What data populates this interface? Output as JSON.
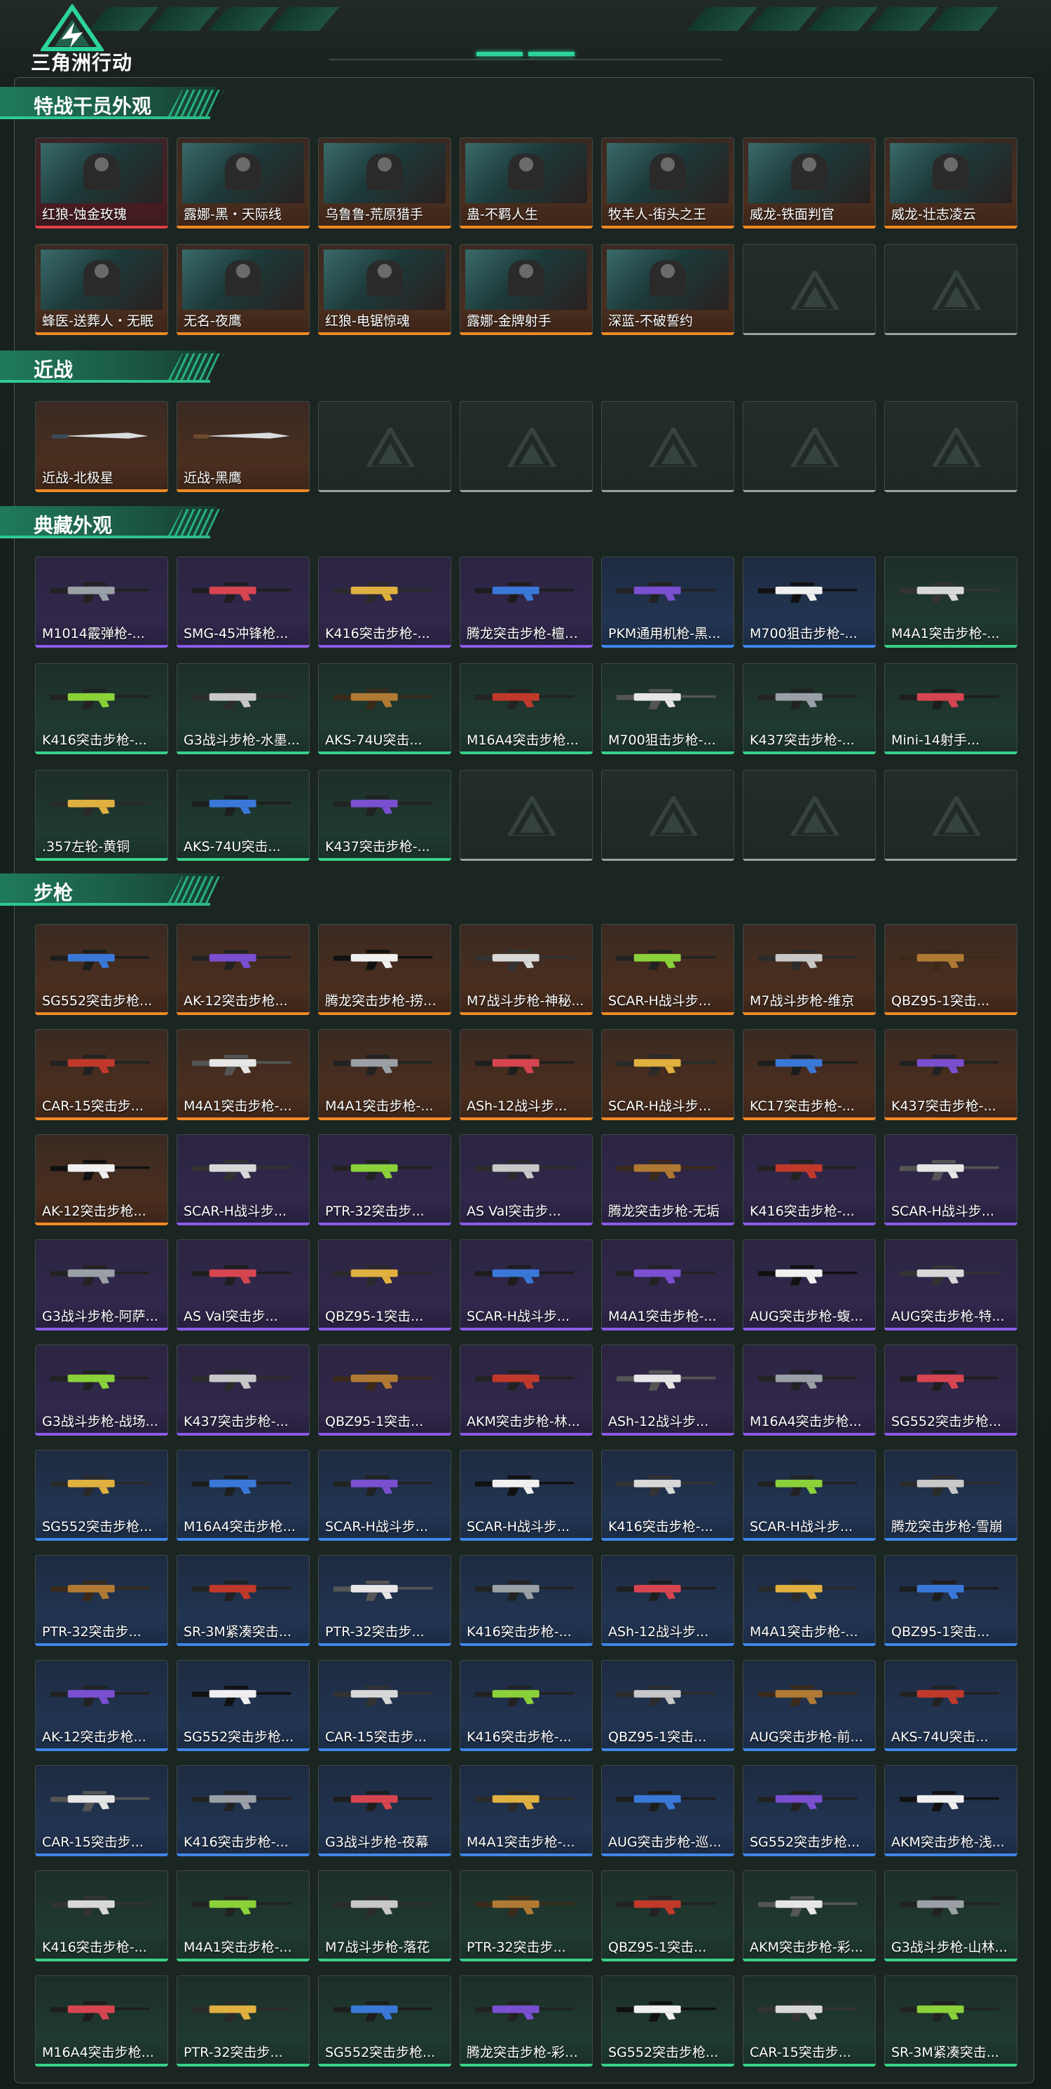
{
  "header": {
    "brand": "三角洲行动"
  },
  "sections": [
    {
      "id": "operators",
      "title": "特战干员外观",
      "items": [
        {
          "label": "红狼-蚀金玫瑰",
          "rarity": "red",
          "kind": "portrait"
        },
        {
          "label": "露娜-黑・天际线",
          "rarity": "orange",
          "kind": "portrait"
        },
        {
          "label": "乌鲁鲁-荒原猎手",
          "rarity": "orange",
          "kind": "portrait"
        },
        {
          "label": "蛊-不羁人生",
          "rarity": "orange",
          "kind": "portrait"
        },
        {
          "label": "牧羊人-街头之王",
          "rarity": "orange",
          "kind": "portrait"
        },
        {
          "label": "威龙-铁面判官",
          "rarity": "orange",
          "kind": "portrait"
        },
        {
          "label": "威龙-壮志凌云",
          "rarity": "orange",
          "kind": "portrait"
        },
        {
          "label": "蜂医-送葬人・无眠",
          "rarity": "orange",
          "kind": "portrait"
        },
        {
          "label": "无名-夜鹰",
          "rarity": "orange",
          "kind": "portrait"
        },
        {
          "label": "红狼-电锯惊魂",
          "rarity": "orange",
          "kind": "portrait"
        },
        {
          "label": "露娜-金牌射手",
          "rarity": "orange",
          "kind": "portrait"
        },
        {
          "label": "深蓝-不破誓约",
          "rarity": "orange",
          "kind": "portrait"
        },
        {
          "label": "",
          "rarity": "empty",
          "kind": "empty"
        },
        {
          "label": "",
          "rarity": "empty",
          "kind": "empty"
        }
      ]
    },
    {
      "id": "melee",
      "title": "近战",
      "items": [
        {
          "label": "近战-北极星",
          "rarity": "orange",
          "kind": "knife"
        },
        {
          "label": "近战-黑鹰",
          "rarity": "orange",
          "kind": "knife"
        },
        {
          "label": "",
          "rarity": "empty",
          "kind": "empty"
        },
        {
          "label": "",
          "rarity": "empty",
          "kind": "empty"
        },
        {
          "label": "",
          "rarity": "empty",
          "kind": "empty"
        },
        {
          "label": "",
          "rarity": "empty",
          "kind": "empty"
        },
        {
          "label": "",
          "rarity": "empty",
          "kind": "empty"
        }
      ]
    },
    {
      "id": "collection",
      "title": "典藏外观",
      "items": [
        {
          "label": "M1014霰弹枪-...",
          "rarity": "purple",
          "kind": "gun"
        },
        {
          "label": "SMG-45冲锋枪...",
          "rarity": "purple",
          "kind": "gun"
        },
        {
          "label": "K416突击步枪-...",
          "rarity": "purple",
          "kind": "gun"
        },
        {
          "label": "腾龙突击步枪-檀劫...",
          "rarity": "purple",
          "kind": "gun"
        },
        {
          "label": "PKM通用机枪-黑...",
          "rarity": "blue",
          "kind": "gun"
        },
        {
          "label": "M700狙击步枪-...",
          "rarity": "blue",
          "kind": "gun"
        },
        {
          "label": "M4A1突击步枪-...",
          "rarity": "green",
          "kind": "gun"
        },
        {
          "label": "K416突击步枪-...",
          "rarity": "green",
          "kind": "gun"
        },
        {
          "label": "G3战斗步枪-水墨...",
          "rarity": "green",
          "kind": "gun"
        },
        {
          "label": "AKS-74U突击...",
          "rarity": "green",
          "kind": "gun"
        },
        {
          "label": "M16A4突击步枪...",
          "rarity": "green",
          "kind": "gun"
        },
        {
          "label": "M700狙击步枪-...",
          "rarity": "green",
          "kind": "gun"
        },
        {
          "label": "K437突击步枪-...",
          "rarity": "green",
          "kind": "gun"
        },
        {
          "label": "Mini-14射手...",
          "rarity": "green",
          "kind": "gun"
        },
        {
          "label": ".357左轮-黄铜",
          "rarity": "green",
          "kind": "gun"
        },
        {
          "label": "AKS-74U突击...",
          "rarity": "green",
          "kind": "gun"
        },
        {
          "label": "K437突击步枪-...",
          "rarity": "green",
          "kind": "gun"
        },
        {
          "label": "",
          "rarity": "empty",
          "kind": "empty"
        },
        {
          "label": "",
          "rarity": "empty",
          "kind": "empty"
        },
        {
          "label": "",
          "rarity": "empty",
          "kind": "empty"
        },
        {
          "label": "",
          "rarity": "empty",
          "kind": "empty"
        }
      ]
    },
    {
      "id": "rifles",
      "title": "步枪",
      "items": [
        {
          "label": "SG552突击步枪...",
          "rarity": "orange",
          "kind": "gun"
        },
        {
          "label": "AK-12突击步枪...",
          "rarity": "orange",
          "kind": "gun"
        },
        {
          "label": "腾龙突击步枪-捞点...",
          "rarity": "orange",
          "kind": "gun"
        },
        {
          "label": "M7战斗步枪-神秘...",
          "rarity": "orange",
          "kind": "gun"
        },
        {
          "label": "SCAR-H战斗步...",
          "rarity": "orange",
          "kind": "gun"
        },
        {
          "label": "M7战斗步枪-维京",
          "rarity": "orange",
          "kind": "gun"
        },
        {
          "label": "QBZ95-1突击...",
          "rarity": "orange",
          "kind": "gun"
        },
        {
          "label": "CAR-15突击步...",
          "rarity": "orange",
          "kind": "gun"
        },
        {
          "label": "M4A1突击步枪-...",
          "rarity": "orange",
          "kind": "gun"
        },
        {
          "label": "M4A1突击步枪-...",
          "rarity": "orange",
          "kind": "gun"
        },
        {
          "label": "ASh-12战斗步...",
          "rarity": "orange",
          "kind": "gun"
        },
        {
          "label": "SCAR-H战斗步...",
          "rarity": "orange",
          "kind": "gun"
        },
        {
          "label": "KC17突击步枪-...",
          "rarity": "orange",
          "kind": "gun"
        },
        {
          "label": "K437突击步枪-...",
          "rarity": "orange",
          "kind": "gun"
        },
        {
          "label": "AK-12突击步枪...",
          "rarity": "orange",
          "kind": "gun"
        },
        {
          "label": "SCAR-H战斗步...",
          "rarity": "purple",
          "kind": "gun"
        },
        {
          "label": "PTR-32突击步...",
          "rarity": "purple",
          "kind": "gun"
        },
        {
          "label": "AS Val突击步...",
          "rarity": "purple",
          "kind": "gun"
        },
        {
          "label": "腾龙突击步枪-无垢",
          "rarity": "purple",
          "kind": "gun"
        },
        {
          "label": "K416突击步枪-...",
          "rarity": "purple",
          "kind": "gun"
        },
        {
          "label": "SCAR-H战斗步...",
          "rarity": "purple",
          "kind": "gun"
        },
        {
          "label": "G3战斗步枪-阿萨...",
          "rarity": "purple",
          "kind": "gun"
        },
        {
          "label": "AS Val突击步...",
          "rarity": "purple",
          "kind": "gun"
        },
        {
          "label": "QBZ95-1突击...",
          "rarity": "purple",
          "kind": "gun"
        },
        {
          "label": "SCAR-H战斗步...",
          "rarity": "purple",
          "kind": "gun"
        },
        {
          "label": "M4A1突击步枪-...",
          "rarity": "purple",
          "kind": "gun"
        },
        {
          "label": "AUG突击步枪-蝮...",
          "rarity": "purple",
          "kind": "gun"
        },
        {
          "label": "AUG突击步枪-特...",
          "rarity": "purple",
          "kind": "gun"
        },
        {
          "label": "G3战斗步枪-战场...",
          "rarity": "purple",
          "kind": "gun"
        },
        {
          "label": "K437突击步枪-...",
          "rarity": "purple",
          "kind": "gun"
        },
        {
          "label": "QBZ95-1突击...",
          "rarity": "purple",
          "kind": "gun"
        },
        {
          "label": "AKM突击步枪-林...",
          "rarity": "purple",
          "kind": "gun"
        },
        {
          "label": "ASh-12战斗步...",
          "rarity": "purple",
          "kind": "gun"
        },
        {
          "label": "M16A4突击步枪...",
          "rarity": "purple",
          "kind": "gun"
        },
        {
          "label": "SG552突击步枪...",
          "rarity": "purple",
          "kind": "gun"
        },
        {
          "label": "SG552突击步枪...",
          "rarity": "blue",
          "kind": "gun"
        },
        {
          "label": "M16A4突击步枪...",
          "rarity": "blue",
          "kind": "gun"
        },
        {
          "label": "SCAR-H战斗步...",
          "rarity": "blue",
          "kind": "gun"
        },
        {
          "label": "SCAR-H战斗步...",
          "rarity": "blue",
          "kind": "gun"
        },
        {
          "label": "K416突击步枪-...",
          "rarity": "blue",
          "kind": "gun"
        },
        {
          "label": "SCAR-H战斗步...",
          "rarity": "blue",
          "kind": "gun"
        },
        {
          "label": "腾龙突击步枪-雪崩",
          "rarity": "blue",
          "kind": "gun"
        },
        {
          "label": "PTR-32突击步...",
          "rarity": "blue",
          "kind": "gun"
        },
        {
          "label": "SR-3M紧凑突击...",
          "rarity": "blue",
          "kind": "gun"
        },
        {
          "label": "PTR-32突击步...",
          "rarity": "blue",
          "kind": "gun"
        },
        {
          "label": "K416突击步枪-...",
          "rarity": "blue",
          "kind": "gun"
        },
        {
          "label": "ASh-12战斗步...",
          "rarity": "blue",
          "kind": "gun"
        },
        {
          "label": "M4A1突击步枪-...",
          "rarity": "blue",
          "kind": "gun"
        },
        {
          "label": "QBZ95-1突击...",
          "rarity": "blue",
          "kind": "gun"
        },
        {
          "label": "AK-12突击步枪...",
          "rarity": "blue",
          "kind": "gun"
        },
        {
          "label": "SG552突击步枪...",
          "rarity": "blue",
          "kind": "gun"
        },
        {
          "label": "CAR-15突击步...",
          "rarity": "blue",
          "kind": "gun"
        },
        {
          "label": "K416突击步枪-...",
          "rarity": "blue",
          "kind": "gun"
        },
        {
          "label": "QBZ95-1突击...",
          "rarity": "blue",
          "kind": "gun"
        },
        {
          "label": "AUG突击步枪-前...",
          "rarity": "blue",
          "kind": "gun"
        },
        {
          "label": "AKS-74U突击...",
          "rarity": "blue",
          "kind": "gun"
        },
        {
          "label": "CAR-15突击步...",
          "rarity": "blue",
          "kind": "gun"
        },
        {
          "label": "K416突击步枪-...",
          "rarity": "blue",
          "kind": "gun"
        },
        {
          "label": "G3战斗步枪-夜幕",
          "rarity": "blue",
          "kind": "gun"
        },
        {
          "label": "M4A1突击步枪-...",
          "rarity": "blue",
          "kind": "gun"
        },
        {
          "label": "AUG突击步枪-巡...",
          "rarity": "blue",
          "kind": "gun"
        },
        {
          "label": "SG552突击步枪...",
          "rarity": "blue",
          "kind": "gun"
        },
        {
          "label": "AKM突击步枪-浅...",
          "rarity": "blue",
          "kind": "gun"
        },
        {
          "label": "K416突击步枪-...",
          "rarity": "green",
          "kind": "gun"
        },
        {
          "label": "M4A1突击步枪-...",
          "rarity": "green",
          "kind": "gun"
        },
        {
          "label": "M7战斗步枪-落花",
          "rarity": "green",
          "kind": "gun"
        },
        {
          "label": "PTR-32突击步...",
          "rarity": "green",
          "kind": "gun"
        },
        {
          "label": "QBZ95-1突击...",
          "rarity": "green",
          "kind": "gun"
        },
        {
          "label": "AKM突击步枪-彩...",
          "rarity": "green",
          "kind": "gun"
        },
        {
          "label": "G3战斗步枪-山林...",
          "rarity": "green",
          "kind": "gun"
        },
        {
          "label": "M16A4突击步枪...",
          "rarity": "green",
          "kind": "gun"
        },
        {
          "label": "PTR-32突击步...",
          "rarity": "green",
          "kind": "gun"
        },
        {
          "label": "SG552突击步枪...",
          "rarity": "green",
          "kind": "gun"
        },
        {
          "label": "腾龙突击步枪-彩墨...",
          "rarity": "green",
          "kind": "gun"
        },
        {
          "label": "SG552突击步枪...",
          "rarity": "green",
          "kind": "gun"
        },
        {
          "label": "CAR-15突击步...",
          "rarity": "green",
          "kind": "gun"
        },
        {
          "label": "SR-3M紧凑突击...",
          "rarity": "green",
          "kind": "gun"
        }
      ]
    }
  ],
  "colors": {
    "orange": "#f08a24",
    "red": "#e0404a",
    "purple": "#8a5ce6",
    "blue": "#3f86e8",
    "green": "#39d08a",
    "accent": "#2dd49a"
  }
}
